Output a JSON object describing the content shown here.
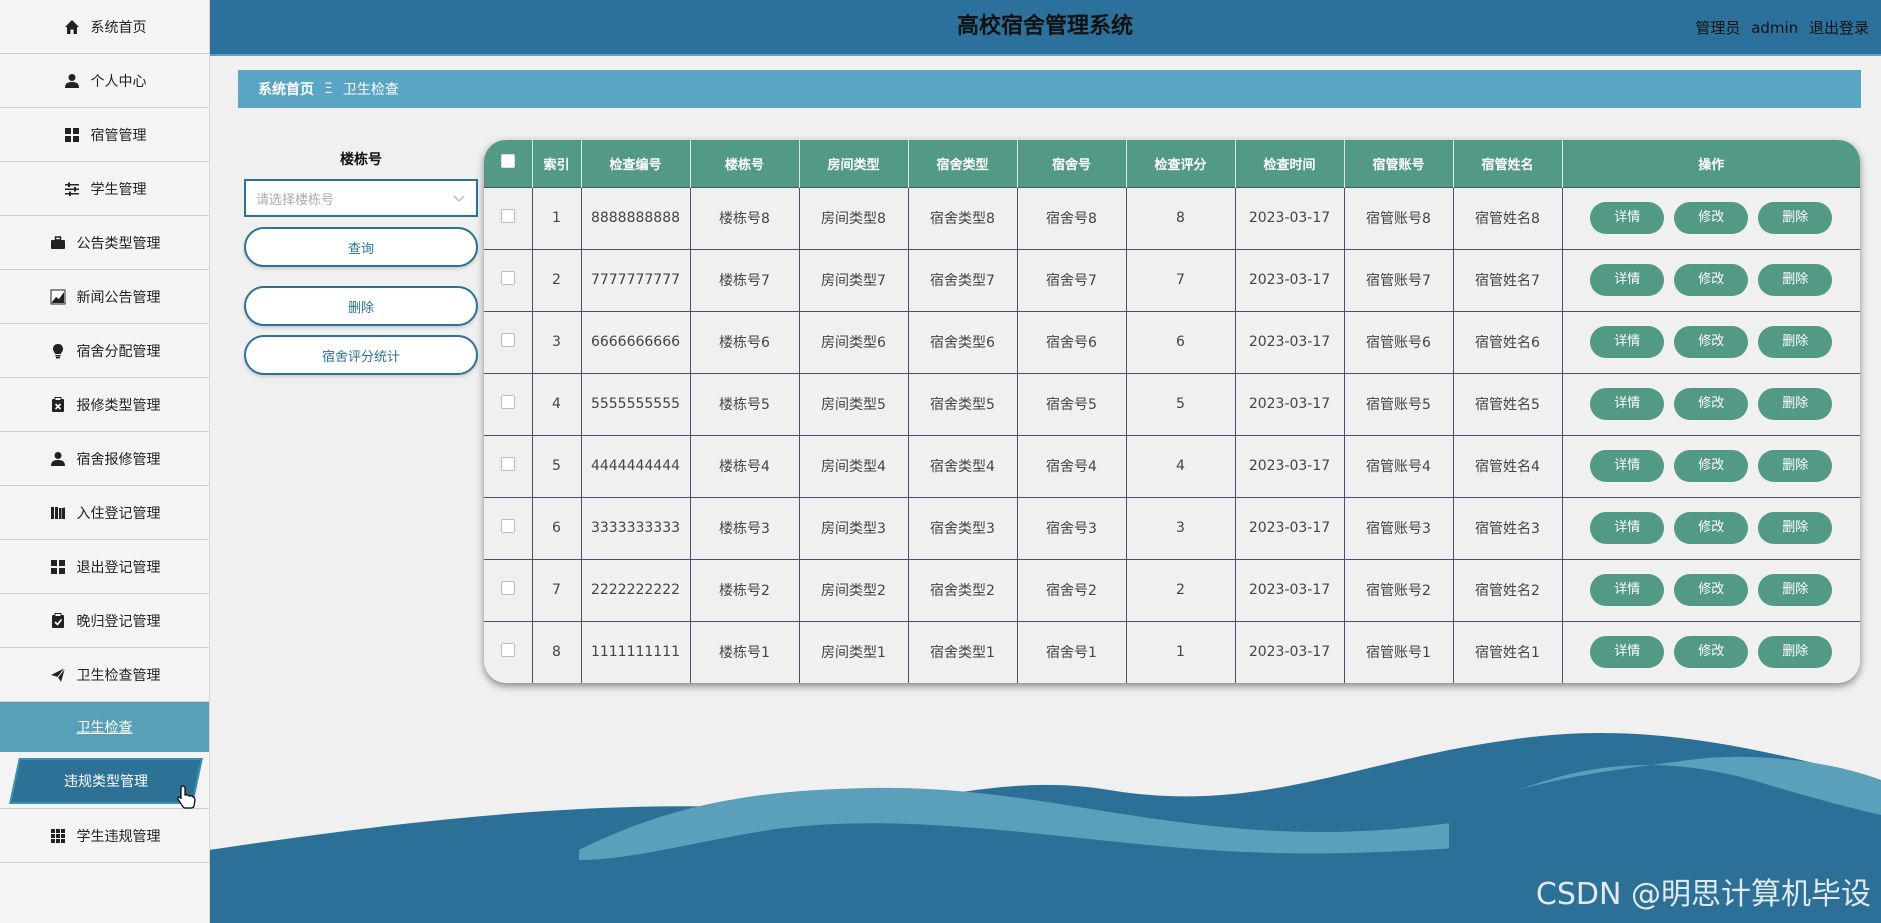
{
  "header": {
    "title": "高校宿舍管理系统",
    "role": "管理员",
    "username": "admin",
    "logout": "退出登录"
  },
  "sidebar": {
    "items": [
      {
        "label": "系统首页",
        "icon": "home-icon"
      },
      {
        "label": "个人中心",
        "icon": "user-icon"
      },
      {
        "label": "宿管管理",
        "icon": "grid-icon"
      },
      {
        "label": "学生管理",
        "icon": "sliders-icon"
      },
      {
        "label": "公告类型管理",
        "icon": "briefcase-icon"
      },
      {
        "label": "新闻公告管理",
        "icon": "chart-icon"
      },
      {
        "label": "宿舍分配管理",
        "icon": "bulb-icon"
      },
      {
        "label": "报修类型管理",
        "icon": "clipboard-x-icon"
      },
      {
        "label": "宿舍报修管理",
        "icon": "user-icon"
      },
      {
        "label": "入住登记管理",
        "icon": "book-icon"
      },
      {
        "label": "退出登记管理",
        "icon": "grid-icon"
      },
      {
        "label": "晚归登记管理",
        "icon": "clipboard-check-icon"
      },
      {
        "label": "卫生检查管理",
        "icon": "send-icon"
      }
    ],
    "sub_item": "卫生检查",
    "active_item": {
      "label": "违规类型管理",
      "icon": "grid-icon"
    },
    "last_item": {
      "label": "学生违规管理",
      "icon": "apps-icon"
    }
  },
  "breadcrumb": {
    "home": "系统首页",
    "separator": "Ξ",
    "current": "卫生检查"
  },
  "search": {
    "label": "楼栋号",
    "placeholder": "请选择楼栋号",
    "query_button": "查询",
    "delete_button": "删除",
    "stats_button": "宿舍评分统计"
  },
  "table": {
    "columns": [
      "索引",
      "检查编号",
      "楼栋号",
      "房间类型",
      "宿舍类型",
      "宿舍号",
      "检查评分",
      "检查时间",
      "宿管账号",
      "宿管姓名",
      "操作"
    ],
    "rows": [
      {
        "index": "1",
        "code": "8888888888",
        "building": "楼栋号8",
        "room_type": "房间类型8",
        "dorm_type": "宿舍类型8",
        "dorm_no": "宿舍号8",
        "score": "8",
        "time": "2023-03-17",
        "account": "宿管账号8",
        "name": "宿管姓名8"
      },
      {
        "index": "2",
        "code": "7777777777",
        "building": "楼栋号7",
        "room_type": "房间类型7",
        "dorm_type": "宿舍类型7",
        "dorm_no": "宿舍号7",
        "score": "7",
        "time": "2023-03-17",
        "account": "宿管账号7",
        "name": "宿管姓名7"
      },
      {
        "index": "3",
        "code": "6666666666",
        "building": "楼栋号6",
        "room_type": "房间类型6",
        "dorm_type": "宿舍类型6",
        "dorm_no": "宿舍号6",
        "score": "6",
        "time": "2023-03-17",
        "account": "宿管账号6",
        "name": "宿管姓名6"
      },
      {
        "index": "4",
        "code": "5555555555",
        "building": "楼栋号5",
        "room_type": "房间类型5",
        "dorm_type": "宿舍类型5",
        "dorm_no": "宿舍号5",
        "score": "5",
        "time": "2023-03-17",
        "account": "宿管账号5",
        "name": "宿管姓名5"
      },
      {
        "index": "5",
        "code": "4444444444",
        "building": "楼栋号4",
        "room_type": "房间类型4",
        "dorm_type": "宿舍类型4",
        "dorm_no": "宿舍号4",
        "score": "4",
        "time": "2023-03-17",
        "account": "宿管账号4",
        "name": "宿管姓名4"
      },
      {
        "index": "6",
        "code": "3333333333",
        "building": "楼栋号3",
        "room_type": "房间类型3",
        "dorm_type": "宿舍类型3",
        "dorm_no": "宿舍号3",
        "score": "3",
        "time": "2023-03-17",
        "account": "宿管账号3",
        "name": "宿管姓名3"
      },
      {
        "index": "7",
        "code": "2222222222",
        "building": "楼栋号2",
        "room_type": "房间类型2",
        "dorm_type": "宿舍类型2",
        "dorm_no": "宿舍号2",
        "score": "2",
        "time": "2023-03-17",
        "account": "宿管账号2",
        "name": "宿管姓名2"
      },
      {
        "index": "8",
        "code": "1111111111",
        "building": "楼栋号1",
        "room_type": "房间类型1",
        "dorm_type": "宿舍类型1",
        "dorm_no": "宿舍号1",
        "score": "1",
        "time": "2023-03-17",
        "account": "宿管账号1",
        "name": "宿管姓名1"
      }
    ],
    "actions": {
      "detail": "详情",
      "edit": "修改",
      "delete": "删除"
    }
  },
  "watermark": "CSDN @明思计算机毕设",
  "colors": {
    "topbar": "#2b719b",
    "accent": "#5aa5c3",
    "table_header": "#529a85",
    "active_nav": "#2d7197"
  }
}
